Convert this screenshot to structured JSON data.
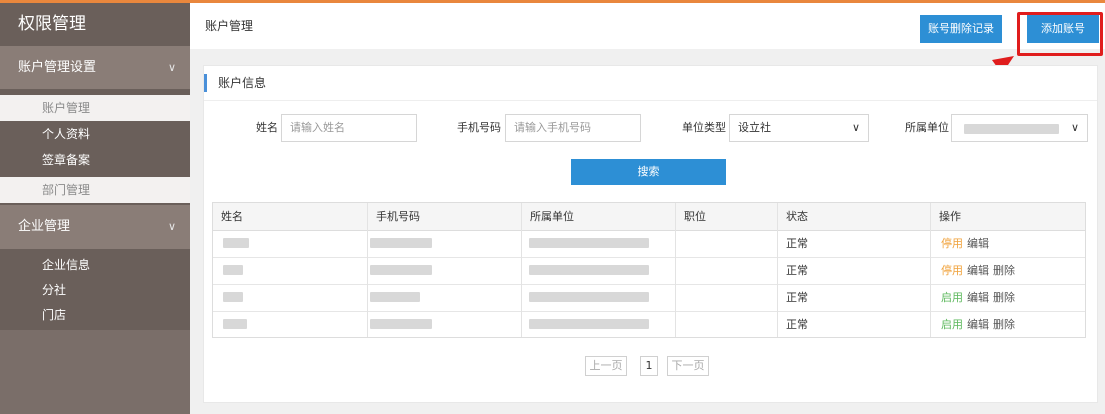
{
  "colors": {
    "accent_orange": "#e9873d",
    "sidebar": "#6a5f5a",
    "primary_blue": "#2d8fd5",
    "highlight_red": "#e01d1d",
    "stop_orange": "#f0a23b",
    "enable_green": "#5cb85c"
  },
  "sidebar": {
    "title": "权限管理",
    "groups": [
      {
        "label": "账户管理设置",
        "icon": "chevron-down-icon",
        "items": [
          {
            "label": "账户管理"
          },
          {
            "label": "个人资料"
          },
          {
            "label": "签章备案"
          },
          {
            "label": "部门管理"
          }
        ]
      },
      {
        "label": "企业管理",
        "icon": "chevron-down-icon",
        "items": [
          {
            "label": "企业信息"
          },
          {
            "label": "分社"
          },
          {
            "label": "门店"
          }
        ]
      }
    ]
  },
  "header": {
    "breadcrumb": "账户管理",
    "delete_log_button": "账号删除记录",
    "add_account_button": "添加账号"
  },
  "panel": {
    "title": "账户信息"
  },
  "filters": {
    "name_label": "姓名",
    "name_placeholder": "请输入姓名",
    "phone_label": "手机号码",
    "phone_placeholder": "请输入手机号码",
    "unit_type_label": "单位类型",
    "unit_type_value": "设立社",
    "unit_label": "所属单位",
    "search_button": "搜索"
  },
  "table": {
    "columns": [
      "姓名",
      "手机号码",
      "所属单位",
      "职位",
      "状态",
      "操作"
    ],
    "rows": [
      {
        "status": "正常",
        "toggle": "停用",
        "edit": "编辑",
        "delete": ""
      },
      {
        "status": "正常",
        "toggle": "停用",
        "edit": "编辑",
        "delete": "删除"
      },
      {
        "status": "正常",
        "toggle": "启用",
        "edit": "编辑",
        "delete": "删除"
      },
      {
        "status": "正常",
        "toggle": "启用",
        "edit": "编辑",
        "delete": "删除"
      }
    ]
  },
  "pagination": {
    "prev": "上一页",
    "current": "1",
    "next": "下一页"
  }
}
